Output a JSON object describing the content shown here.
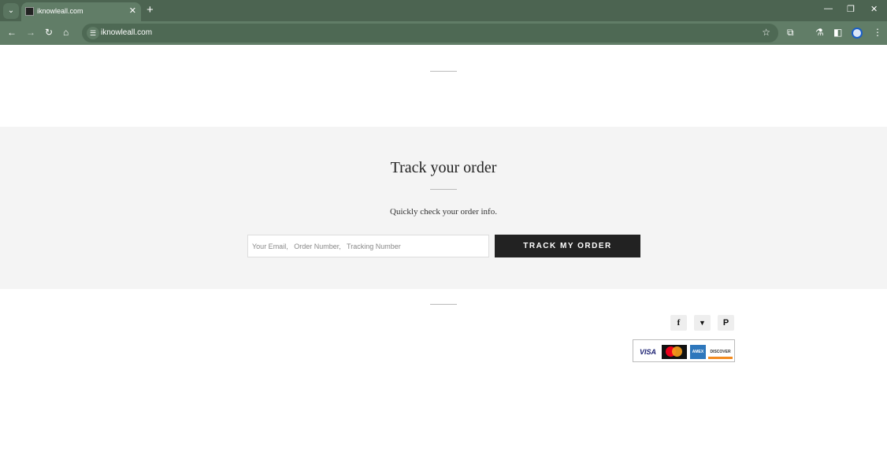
{
  "browser": {
    "tab_title": "iknowleall.com",
    "url": "iknowleall.com"
  },
  "track": {
    "title": "Track your order",
    "subtitle": "Quickly check your order info.",
    "input_placeholder": "Your Email,   Order Number,   Tracking Number",
    "button_label": "TRACK MY ORDER"
  },
  "social": [
    {
      "icon": "facebook-icon",
      "glyph": "f"
    },
    {
      "icon": "twitter-icon",
      "glyph": "🐦"
    },
    {
      "icon": "pinterest-icon",
      "glyph": "P"
    }
  ],
  "payments": [
    "VISA",
    "mastercard",
    "AMEX",
    "DISCOVER"
  ]
}
